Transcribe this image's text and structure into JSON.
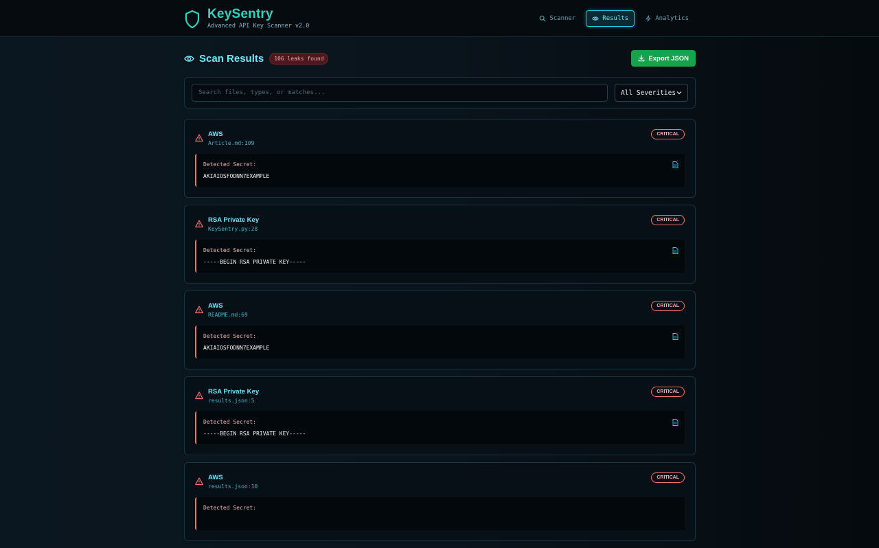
{
  "app": {
    "name": "KeySentry",
    "subtitle": "Advanced API Key Scanner v2.0"
  },
  "nav": {
    "items": [
      {
        "label": "Scanner",
        "icon": "search-icon",
        "active": false
      },
      {
        "label": "Results",
        "icon": "eye-icon",
        "active": true
      },
      {
        "label": "Analytics",
        "icon": "bolt-icon",
        "active": false
      }
    ]
  },
  "results": {
    "title": "Scan Results",
    "leak_badge": "106 leaks found",
    "export_label": "Export JSON",
    "search_placeholder": "Search files, types, or matches...",
    "severity_filter": "All Severities",
    "secret_label": "Detected Secret:",
    "cards": [
      {
        "type": "AWS",
        "file": "Article.md:109",
        "severity": "CRITICAL",
        "secret": "AKIAIOSFODNN7EXAMPLE"
      },
      {
        "type": "RSA Private Key",
        "file": "KeySentry.py:28",
        "severity": "CRITICAL",
        "secret": "-----BEGIN RSA PRIVATE KEY-----"
      },
      {
        "type": "AWS",
        "file": "README.md:69",
        "severity": "CRITICAL",
        "secret": "AKIAIOSFODNN7EXAMPLE"
      },
      {
        "type": "RSA Private Key",
        "file": "results.json:5",
        "severity": "CRITICAL",
        "secret": "-----BEGIN RSA PRIVATE KEY-----"
      },
      {
        "type": "AWS",
        "file": "results.json:10",
        "severity": "CRITICAL",
        "secret": ""
      }
    ]
  },
  "colors": {
    "accent": "#67e8f9",
    "brand": "#2dd4bf",
    "critical": "#f87171",
    "export": "#16a34a"
  }
}
